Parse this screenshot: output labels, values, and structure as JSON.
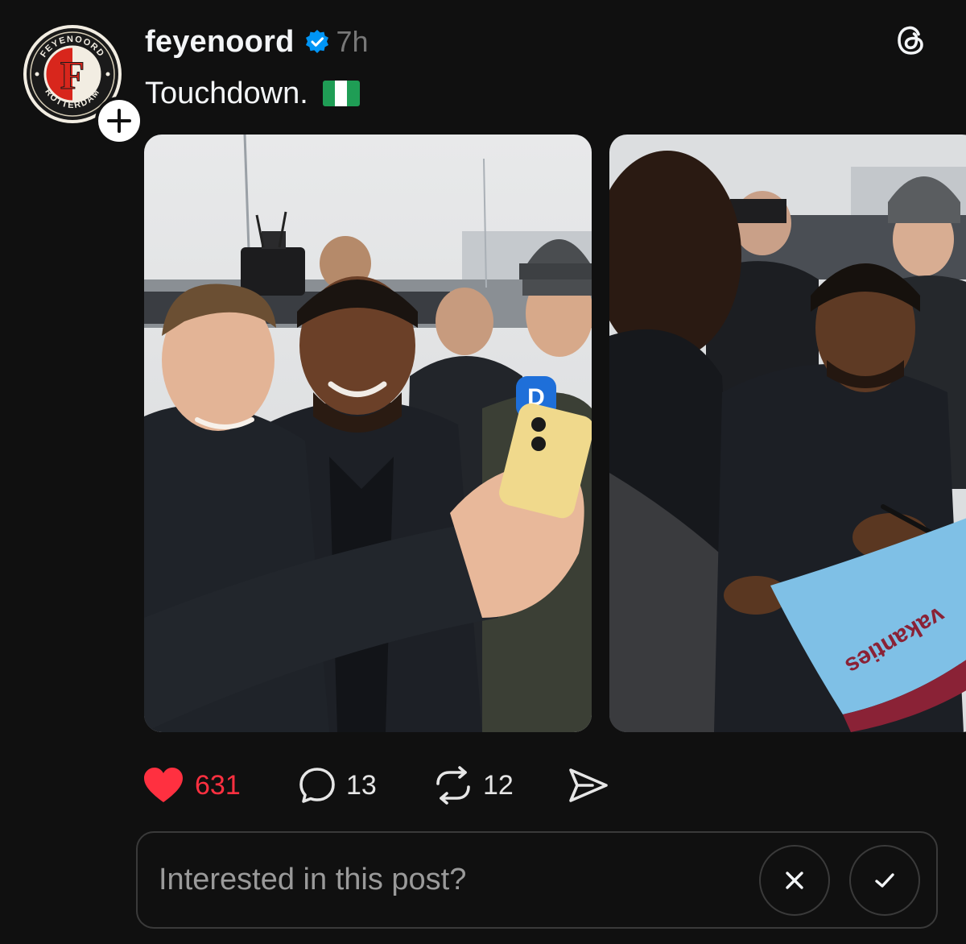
{
  "post": {
    "username": "feyenoord",
    "time": "7h",
    "caption": "Touchdown.",
    "avatar": {
      "logo_top_text": "FEYENOORD",
      "logo_bottom_text": "ROTTERDAM",
      "logo_letter": "F"
    },
    "verified": true,
    "flag": "nigeria-flag",
    "media": [
      {
        "name": "selfie-photo",
        "description": "player-selfie"
      },
      {
        "name": "signing-photo",
        "jersey_text": "vakanties"
      }
    ]
  },
  "actions": {
    "likes": "631",
    "replies": "13",
    "reposts": "12",
    "liked": true
  },
  "interest_prompt": {
    "text": "Interested in this post?",
    "dismiss_icon": "close-icon",
    "confirm_icon": "check-icon"
  },
  "colors": {
    "background": "#101010",
    "like_red": "#ff3040",
    "verified_blue": "#0095f6",
    "muted": "#777777"
  }
}
